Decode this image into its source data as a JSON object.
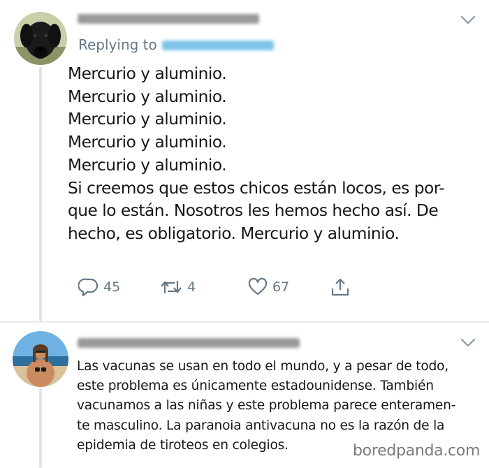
{
  "tweet1": {
    "replying_to_label": "Replying to",
    "lines": [
      "Mercurio y aluminio.",
      "Mercurio y aluminio.",
      "Mercurio y aluminio.",
      "Mercurio y aluminio.",
      "Mercurio y aluminio.",
      "Si creemos que estos chicos están locos, es por-",
      "que lo están. Nosotros les hemos hecho así. De",
      "hecho, es obligatorio. Mercurio y aluminio."
    ],
    "actions": {
      "replies": "45",
      "retweets": "4",
      "likes": "67"
    }
  },
  "tweet2": {
    "lines": [
      "Las vacunas se usan en todo el mundo, y a pesar de todo,",
      "este problema es únicamente estadounidense. También",
      "vacunamos a las niñas y este problema parece enteramen-",
      "te masculino. La paranoia antivacuna no es la razón de la",
      "epidemia de tiroteos en colegios."
    ]
  },
  "watermark": "boredpanda.com",
  "colors": {
    "text": "#14171a",
    "muted": "#657786",
    "mention_blur": "#7ec3ea",
    "thread_line": "#dfe4e8"
  }
}
